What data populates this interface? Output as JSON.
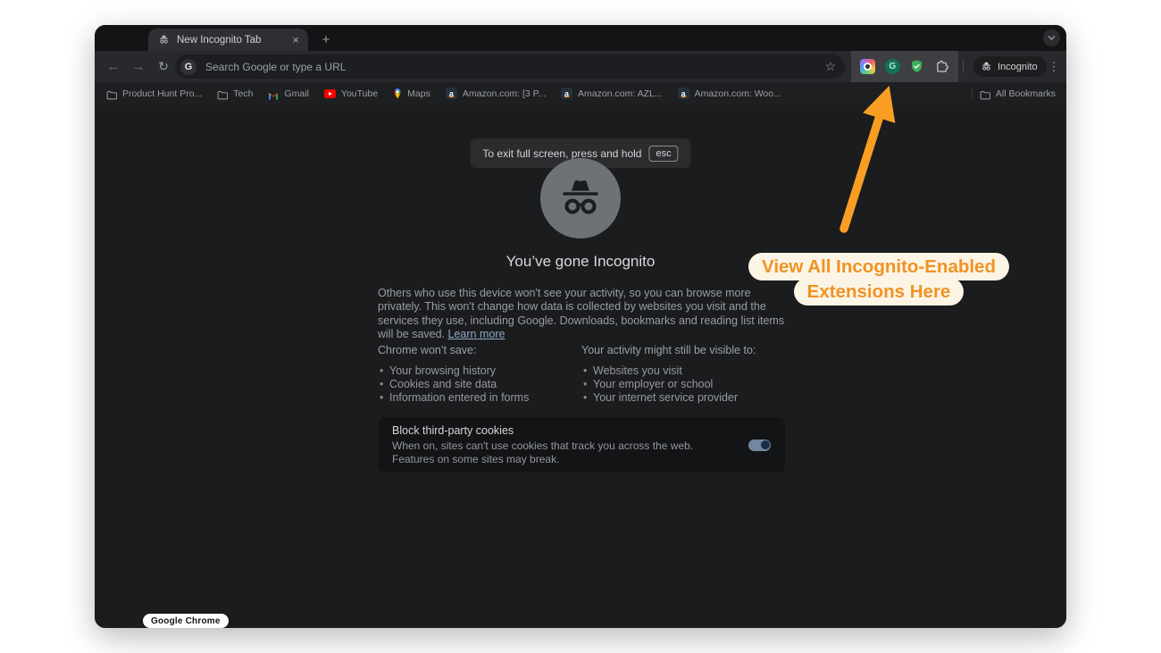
{
  "colors": {
    "annotation_orange": "#EF9324",
    "arrow_orange": "#F89E23",
    "callout_bg": "#FCF4E5",
    "toolbar_bg": "#28292C",
    "content_bg": "#1B1C1E",
    "card_bg": "#131416",
    "toggle_track": "#74859E",
    "toggle_knob": "#1A2C47",
    "shield_green": "#3FAE5A",
    "link_color": "#8FA9C7"
  },
  "tab_strip": {
    "tab_title": "New Incognito Tab",
    "close_icon": "×",
    "new_tab_icon": "+"
  },
  "toolbar": {
    "back_icon": "←",
    "forward_icon": "→",
    "reload_icon": "↻",
    "star_icon": "☆",
    "menu_icon": "⋮",
    "omnibox": {
      "g_label": "G",
      "placeholder": "Search Google or type a URL"
    },
    "grammarly_letter": "G",
    "incognito_badge_label": "Incognito"
  },
  "bookmarks_bar": {
    "amazon_favicon_letter": "a",
    "items": [
      {
        "label": "Product Hunt Pro...",
        "icon": "folder"
      },
      {
        "label": "Tech",
        "icon": "folder"
      },
      {
        "label": "Gmail",
        "icon": "gmail"
      },
      {
        "label": "YouTube",
        "icon": "youtube"
      },
      {
        "label": "Maps",
        "icon": "maps"
      },
      {
        "label": "Amazon.com: [3 P...",
        "icon": "amazon"
      },
      {
        "label": "Amazon.com: AZL...",
        "icon": "amazon"
      },
      {
        "label": "Amazon.com: Woo...",
        "icon": "amazon"
      }
    ],
    "all_bookmarks_label": "All Bookmarks"
  },
  "page": {
    "fullscreen_toast": {
      "text": "To exit full screen, press and hold",
      "key_label": "esc"
    },
    "title": "You’ve gone Incognito",
    "intro": "Others who use this device won't see your activity, so you can browse more privately. This won't change how data is collected by websites you visit and the services they use, including Google. Downloads, bookmarks and reading list items will be saved. ",
    "learn_more_label": "Learn more",
    "wont_save": {
      "heading": "Chrome won’t save:",
      "items": [
        "Your browsing history",
        "Cookies and site data",
        "Information entered in forms"
      ]
    },
    "still_visible": {
      "heading": "Your activity might still be visible to:",
      "items": [
        "Websites you visit",
        "Your employer or school",
        "Your internet service provider"
      ]
    },
    "cookies_card": {
      "title": "Block third-party cookies",
      "description": "When on, sites can't use cookies that track you across the web. Features on some sites may break.",
      "toggle_state": "on"
    }
  },
  "annotation": {
    "line1": "View All Incognito-Enabled",
    "line2": "Extensions Here"
  },
  "os_badge_label": "Google Chrome"
}
